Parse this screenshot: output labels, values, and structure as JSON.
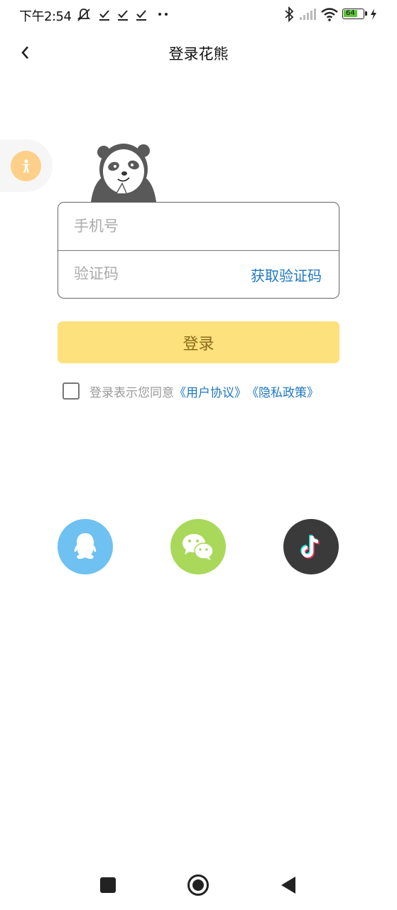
{
  "status_bar": {
    "time": "下午2:54",
    "battery": "64",
    "icons": [
      "mute-icon",
      "check-icon",
      "check-icon",
      "check-icon",
      "more-dots-icon",
      "bluetooth-icon",
      "signal-icon",
      "wifi-icon",
      "battery-icon",
      "charging-icon"
    ]
  },
  "header": {
    "title": "登录花熊",
    "back_icon": "chevron-left-icon"
  },
  "accessibility_button": {
    "icon": "accessibility-icon",
    "color": "#fdd089"
  },
  "mascot": {
    "icon": "panda-mascot"
  },
  "form": {
    "phone_placeholder": "手机号",
    "code_placeholder": "验证码",
    "get_code_label": "获取验证码"
  },
  "login_button": {
    "label": "登录",
    "color": "#fde17c"
  },
  "agreement": {
    "prefix": "登录表示您同意",
    "user_agreement": "《用户协议》",
    "privacy_policy": "《隐私政策》"
  },
  "social_login": [
    {
      "name": "qq",
      "icon": "qq-icon",
      "color": "#6ec1f1"
    },
    {
      "name": "wechat",
      "icon": "wechat-icon",
      "color": "#a9d85a"
    },
    {
      "name": "tiktok",
      "icon": "tiktok-icon",
      "color": "#3b3a3a"
    }
  ],
  "nav_bar": {
    "icons": [
      "recents-square-icon",
      "home-circle-icon",
      "back-triangle-icon"
    ]
  }
}
